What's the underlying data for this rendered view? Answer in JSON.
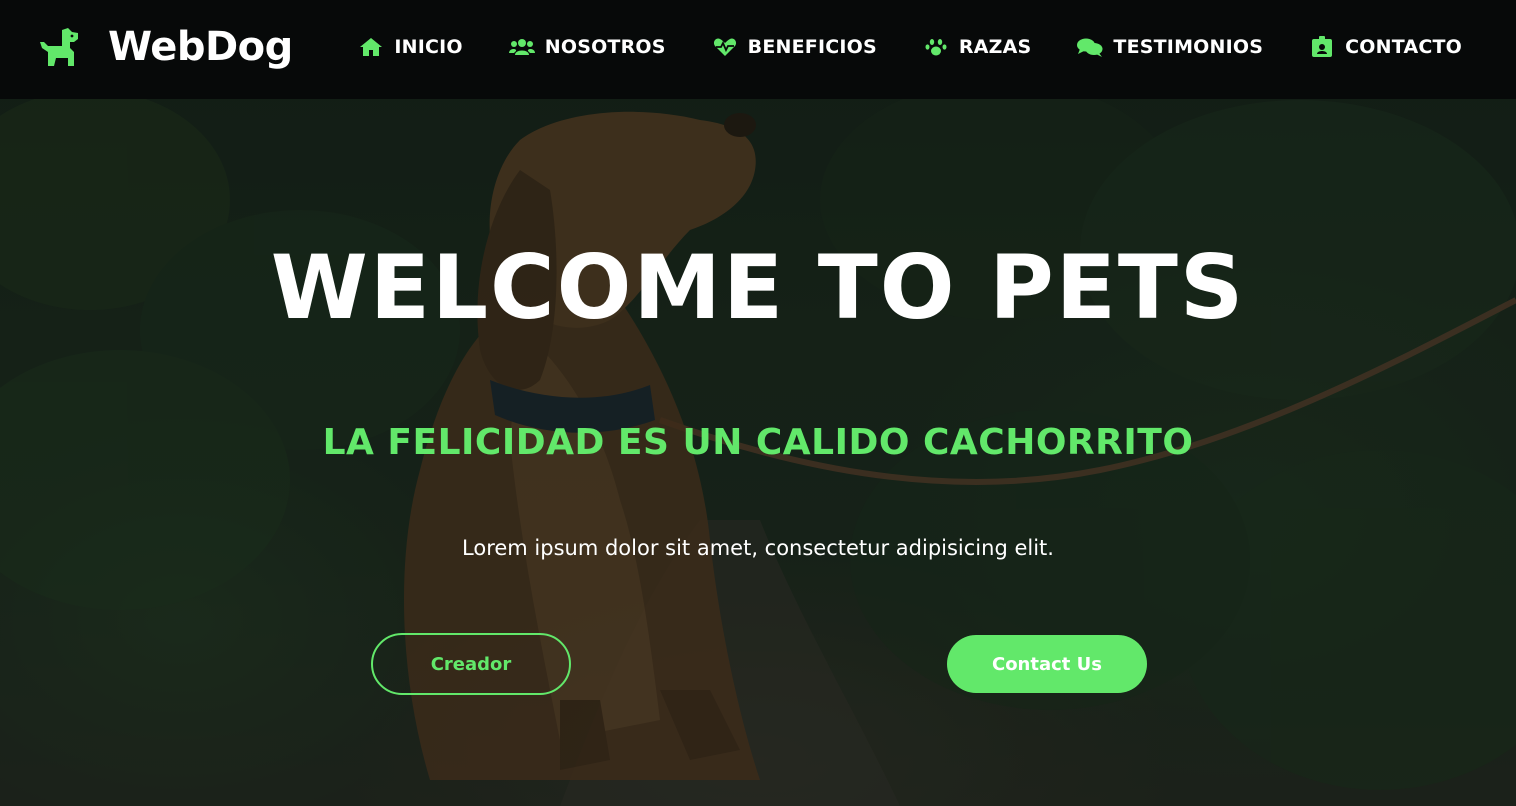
{
  "brand": {
    "name": "WebDog",
    "icon": "dog-icon"
  },
  "nav": {
    "items": [
      {
        "label": "INICIO",
        "icon": "home-icon"
      },
      {
        "label": "NOSOTROS",
        "icon": "users-icon"
      },
      {
        "label": "BENEFICIOS",
        "icon": "heartbeat-icon"
      },
      {
        "label": "RAZAS",
        "icon": "paw-icon"
      },
      {
        "label": "TESTIMONIOS",
        "icon": "comments-icon"
      },
      {
        "label": "CONTACTO",
        "icon": "id-badge-icon"
      }
    ]
  },
  "hero": {
    "title": "WELCOME TO PETS",
    "subtitle": "LA FELICIDAD ES UN CALIDO CACHORRITO",
    "text": "Lorem ipsum dolor sit amet, consectetur adipisicing elit.",
    "buttons": {
      "creator": "Creador",
      "contact": "Contact Us"
    }
  },
  "colors": {
    "accent": "#62e86a",
    "navbar": "#070909",
    "text": "#ffffff"
  }
}
